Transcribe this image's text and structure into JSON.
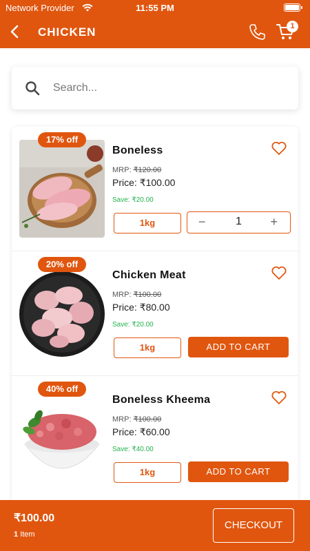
{
  "status_bar": {
    "carrier": "Network Provider",
    "time": "11:55 PM"
  },
  "header": {
    "title": "CHICKEN",
    "cart_count": "1"
  },
  "search": {
    "placeholder": "Search..."
  },
  "products": [
    {
      "name": "Boneless",
      "discount": "17% off",
      "mrp_label": "MRP:",
      "mrp": "₹120.00",
      "price_label": "Price:",
      "price": "₹100.00",
      "save_label": "Save:",
      "save": "₹20.00",
      "unit": "1kg",
      "quantity": "1",
      "qty_minus": "−",
      "qty_plus": "+"
    },
    {
      "name": "Chicken Meat",
      "discount": "20% off",
      "mrp_label": "MRP:",
      "mrp": "₹100.00",
      "price_label": "Price:",
      "price": "₹80.00",
      "save_label": "Save:",
      "save": "₹20.00",
      "unit": "1kg",
      "button": "ADD TO CART"
    },
    {
      "name": "Boneless Kheema",
      "discount": "40% off",
      "mrp_label": "MRP:",
      "mrp": "₹100.00",
      "price_label": "Price:",
      "price": "₹60.00",
      "save_label": "Save:",
      "save": "₹40.00",
      "unit": "1kg",
      "button": "ADD TO CART"
    }
  ],
  "checkout": {
    "total": "₹100.00",
    "items_count": "1",
    "items_label": "Item",
    "button": "CHECKOUT"
  },
  "colors": {
    "brand": "#e0560f",
    "save_green": "#22b14c"
  },
  "icons": [
    "back-arrow-icon",
    "phone-icon",
    "cart-icon",
    "search-icon",
    "heart-icon",
    "wifi-icon",
    "battery-icon"
  ]
}
